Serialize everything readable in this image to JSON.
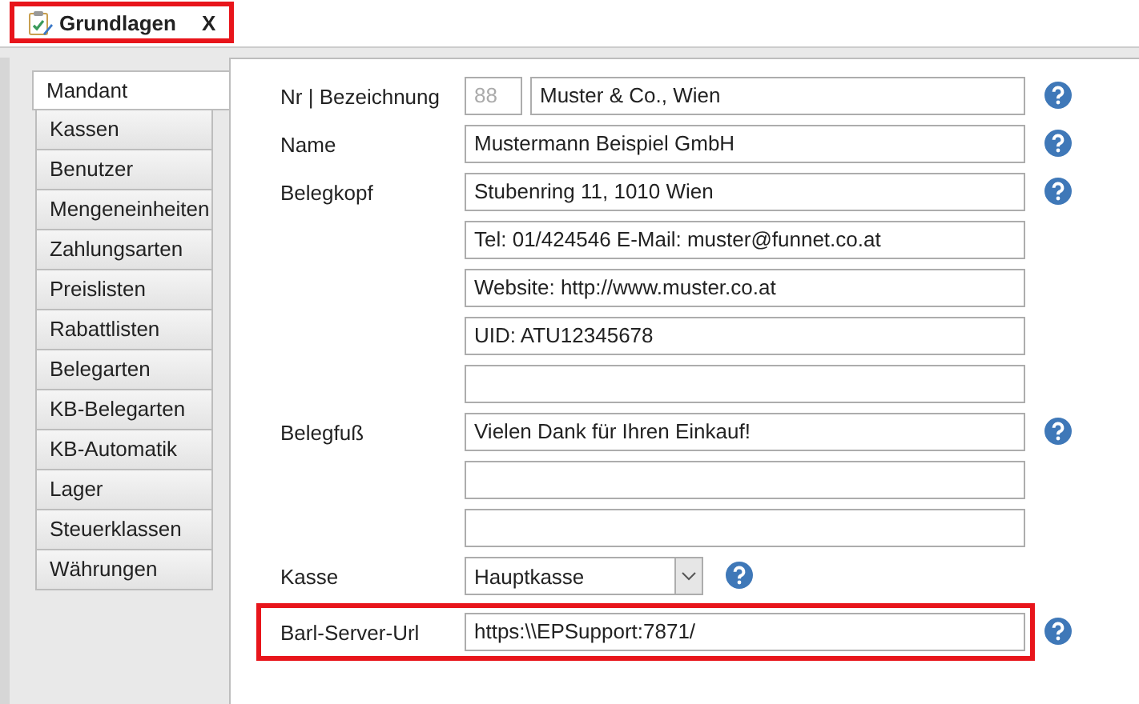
{
  "document_tab": {
    "label": "Grundlagen",
    "close": "X",
    "highlighted": true
  },
  "sections": [
    {
      "label": "Mandant",
      "selected": true
    },
    {
      "label": "Kassen",
      "selected": false
    },
    {
      "label": "Benutzer",
      "selected": false
    },
    {
      "label": "Mengeneinheiten",
      "selected": false
    },
    {
      "label": "Zahlungsarten",
      "selected": false
    },
    {
      "label": "Preislisten",
      "selected": false
    },
    {
      "label": "Rabattlisten",
      "selected": false
    },
    {
      "label": "Belegarten",
      "selected": false
    },
    {
      "label": "KB-Belegarten",
      "selected": false
    },
    {
      "label": "KB-Automatik",
      "selected": false
    },
    {
      "label": "Lager",
      "selected": false
    },
    {
      "label": "Steuerklassen",
      "selected": false
    },
    {
      "label": "Währungen",
      "selected": false
    }
  ],
  "form": [
    {
      "kind": "pair",
      "label": "Nr | Bezeichnung",
      "number": "88",
      "value": "Muster & Co., Wien",
      "help": true,
      "highlighted": false
    },
    {
      "kind": "text",
      "label": "Name",
      "value": "Mustermann Beispiel GmbH",
      "help": true,
      "highlighted": false
    },
    {
      "kind": "text",
      "label": "Belegkopf",
      "value": "Stubenring 11, 1010 Wien",
      "help": true,
      "highlighted": false
    },
    {
      "kind": "text",
      "value": "Tel: 01/424546 E-Mail: muster@funnet.co.at",
      "help": false,
      "highlighted": false
    },
    {
      "kind": "text",
      "value": "Website: http://www.muster.co.at",
      "help": false,
      "highlighted": false
    },
    {
      "kind": "text",
      "value": "UID: ATU12345678",
      "help": false,
      "highlighted": false
    },
    {
      "kind": "text",
      "help": false,
      "highlighted": false
    },
    {
      "kind": "text",
      "label": "Belegfuß",
      "value": "Vielen Dank für Ihren Einkauf!",
      "help": true,
      "highlighted": false
    },
    {
      "kind": "text",
      "help": false,
      "highlighted": false
    },
    {
      "kind": "text",
      "help": false,
      "highlighted": false
    },
    {
      "kind": "dropdown",
      "label": "Kasse",
      "value": "Hauptkasse",
      "help": true,
      "highlighted": false
    },
    {
      "kind": "text",
      "label": "Barl-Server-Url",
      "value": "https:\\\\EPSupport:7871/",
      "help": true,
      "highlighted": true
    }
  ]
}
